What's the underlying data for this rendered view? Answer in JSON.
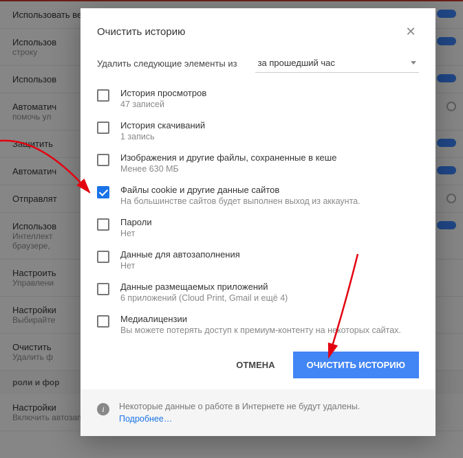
{
  "background": {
    "items": [
      {
        "title": "Использовать веб-службу для разрешения проблем, связанных с навигацией",
        "sub": "",
        "ctrl": "toggle"
      },
      {
        "title": "Использов",
        "sub": "строку",
        "ctrl": "toggle"
      },
      {
        "title": "Использов",
        "sub": "",
        "ctrl": "toggle"
      },
      {
        "title": "Автоматич",
        "sub": "помочь ул",
        "ctrl": "radio"
      },
      {
        "title": "Защитить",
        "sub": "",
        "ctrl": "toggle"
      },
      {
        "title": "Автоматич",
        "sub": "",
        "ctrl": "toggle"
      },
      {
        "title": "Отправлят",
        "sub": "",
        "ctrl": "radio"
      },
      {
        "title": "Использов",
        "sub": "Интеллект\nбраузере,",
        "ctrl": "toggle"
      },
      {
        "title": "Настроить",
        "sub": "Управлени",
        "ctrl": ""
      },
      {
        "title": "Настройки",
        "sub": "Выбирайте",
        "ctrl": ""
      },
      {
        "title": "Очистить",
        "sub": "Удалить ф",
        "ctrl": ""
      }
    ],
    "section": "роли и фор",
    "footer_item": {
      "title": "Настройки",
      "sub": "Включить автозаполнение для быстрого добавления данных в веб-формы"
    }
  },
  "dialog": {
    "title": "Очистить историю",
    "delete_label": "Удалить следующие элементы из",
    "time_range": "за прошедший час",
    "items": [
      {
        "label": "История просмотров",
        "desc": "47 записей",
        "checked": false
      },
      {
        "label": "История скачиваний",
        "desc": "1 запись",
        "checked": false
      },
      {
        "label": "Изображения и другие файлы, сохраненные в кеше",
        "desc": "Менее 630 МБ",
        "checked": false
      },
      {
        "label": "Файлы cookie и другие данные сайтов",
        "desc": "На большинстве сайтов будет выполнен выход из аккаунта.",
        "checked": true
      },
      {
        "label": "Пароли",
        "desc": "Нет",
        "checked": false
      },
      {
        "label": "Данные для автозаполнения",
        "desc": "Нет",
        "checked": false
      },
      {
        "label": "Данные размещаемых приложений",
        "desc": "6 приложений (Cloud Print, Gmail и ещё 4)",
        "checked": false
      },
      {
        "label": "Медиалицензии",
        "desc": "Вы можете потерять доступ к премиум-контенту на некоторых сайтах.",
        "checked": false
      }
    ],
    "cancel": "ОТМЕНА",
    "confirm": "ОЧИСТИТЬ ИСТОРИЮ",
    "footer_note": "Некоторые данные о работе в Интернете не будут удалены.",
    "footer_link": "Подробнее…"
  }
}
